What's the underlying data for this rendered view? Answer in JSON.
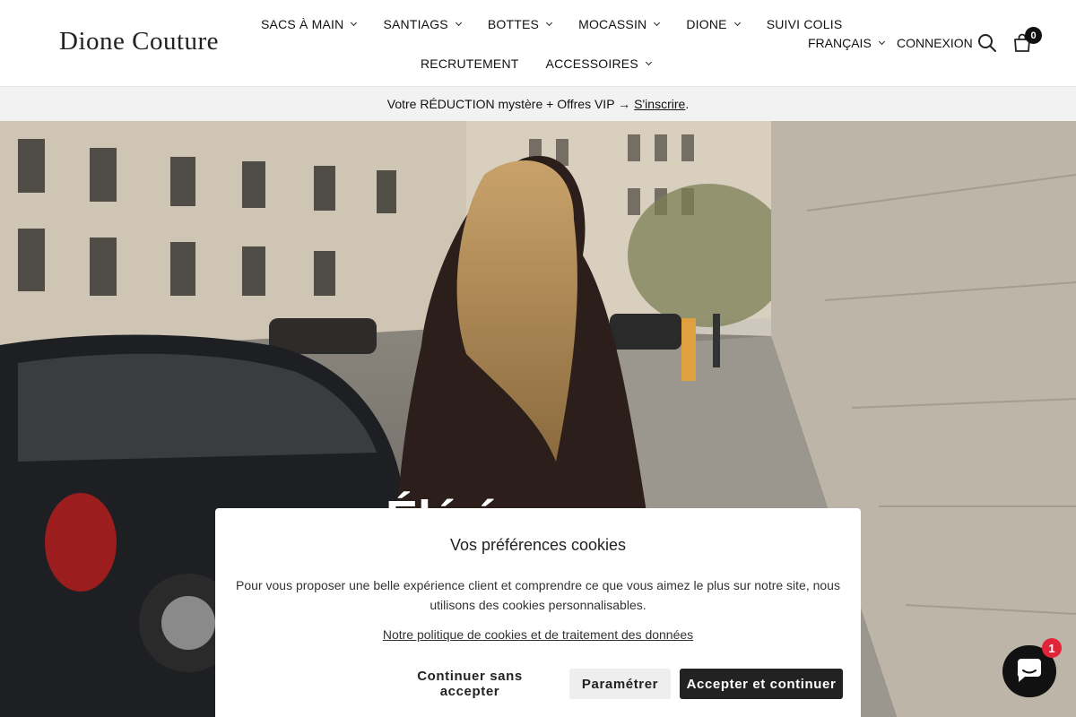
{
  "header": {
    "logo": "Dione Couture",
    "nav_row1": [
      {
        "label": "SACS À MAIN",
        "dropdown": true
      },
      {
        "label": "SANTIAGS",
        "dropdown": true
      },
      {
        "label": "BOTTES",
        "dropdown": true
      },
      {
        "label": "MOCASSIN",
        "dropdown": true
      },
      {
        "label": "DIONE",
        "dropdown": true
      },
      {
        "label": "SUIVI COLIS",
        "dropdown": false
      }
    ],
    "nav_row2": [
      {
        "label": "RECRUTEMENT",
        "dropdown": false
      },
      {
        "label": "ACCESSOIRES",
        "dropdown": true
      }
    ],
    "language": "FRANÇAIS",
    "login": "CONNEXION",
    "search_icon": "search-icon",
    "cart_icon": "shopping-bag-icon",
    "cart_count": "0"
  },
  "announcement": {
    "text": "Votre RÉDUCTION mystère + Offres VIP →",
    "link": "S'inscrire",
    "suffix": "."
  },
  "hero": {
    "heading_partial": "Élé         é"
  },
  "cookie": {
    "title": "Vos préférences cookies",
    "text": "Pour vous proposer une belle expérience client et comprendre ce que vous aimez le plus sur notre site, nous utilisons des cookies personnalisables.",
    "policy_link": "Notre politique de cookies et de traitement des données",
    "continue_label": "Continuer sans accepter",
    "settings_label": "Paramétrer",
    "accept_label": "Accepter et continuer"
  },
  "chat": {
    "icon": "chat-bubble-icon",
    "badge": "1"
  },
  "colors": {
    "accent": "#222222",
    "badge_red": "#e0243a",
    "announcement_bg": "#f2f2f2"
  }
}
